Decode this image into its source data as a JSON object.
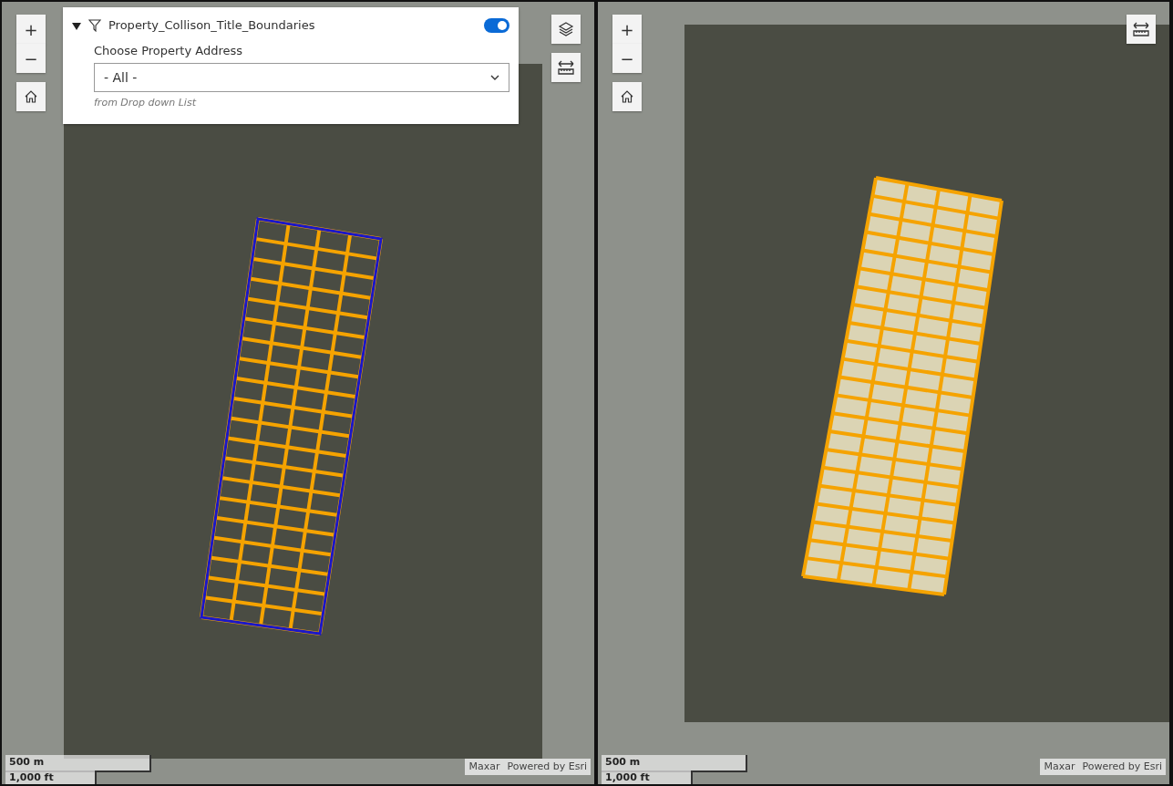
{
  "maps": [
    {
      "zoom_controls": {
        "zoom_in": "+",
        "zoom_out": "−"
      },
      "tools": [
        {
          "kind": "layers"
        },
        {
          "kind": "measure"
        }
      ],
      "filter_panel": {
        "expanded": true,
        "layer": "Property_Collison_Title_Boundaries",
        "on": true,
        "label": "Choose Property Address",
        "value": "- All -",
        "hint": "from Drop down List"
      },
      "boundary_outline": true,
      "scale_bar": {
        "metric": "500 m",
        "imperial": "1,000 ft"
      },
      "attribution": [
        "Maxar",
        "Powered by Esri"
      ]
    },
    {
      "zoom_controls": {
        "zoom_in": "+",
        "zoom_out": "−"
      },
      "tools": [
        {
          "kind": "measure"
        }
      ],
      "boundary_outline": false,
      "scale_bar": {
        "metric": "500 m",
        "imperial": "1,000 ft"
      },
      "attribution": [
        "Maxar",
        "Powered by Esri"
      ]
    }
  ]
}
